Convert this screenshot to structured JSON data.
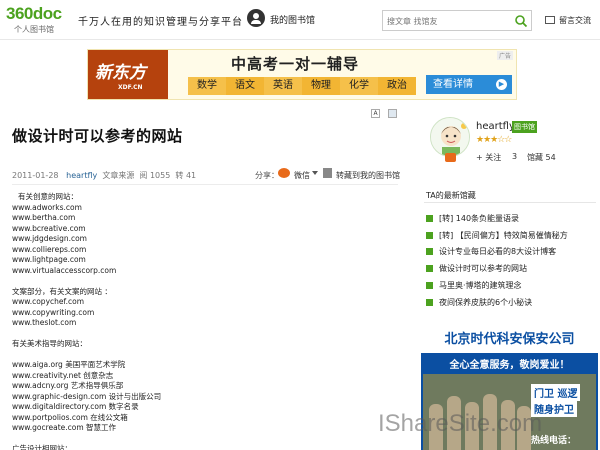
{
  "header": {
    "logo": "360doc",
    "logo_sub": "个人图书馆",
    "slogan": "千万人在用的知识管理与分享平台",
    "my_library": "我的图书馆",
    "search_placeholder": "搜文章 找馆友",
    "messages": "留言交流"
  },
  "ad_banner": {
    "logo_text": "新东方",
    "logo_sub": "XDF.CN",
    "title": "中高考一对一辅导",
    "subjects": [
      "数学",
      "语文",
      "英语",
      "物理",
      "化学",
      "政治"
    ],
    "button": "查看详情",
    "tag": "广告"
  },
  "article": {
    "font_toggle": "A",
    "title": "做设计时可以参考的网站",
    "date": "2011-01-28",
    "author": "heartfly",
    "source_label": "文章来源",
    "reads": "阅 1055",
    "reposts": "转 41",
    "share_label": "分享：",
    "wechat": "微信",
    "save_label": "转藏到我的图书馆",
    "lines": [
      "有关创意的网站：",
      "www.adworks.com",
      "www.bertha.com",
      "www.bcreative.com",
      "www.jdgdesign.com",
      "www.colliereps.com",
      "www.lightpage.com",
      "www.virtualaccesscorp.com",
      "",
      "文案部分，有关文案的网站 ：",
      "www.copychef.com",
      "www.copywriting.com",
      "www.theslot.com",
      "",
      "有关美术指导的网站：",
      "",
      "www.aiga.org 美国平面艺术学院",
      "www.creativity.net 创意杂志",
      "www.adcny.org 艺术指导俱乐部",
      "www.graphic-design.com 设计与出版公司",
      "www.digitaldirectory.com 数字名录",
      "www.portpolios.com 在线公文箱",
      "www.gocreate.com 智慧工作",
      "",
      "广告设计相网站："
    ]
  },
  "profile": {
    "name": "heartfly",
    "badge": "图书馆",
    "stars": "★★★☆☆",
    "follow": "+ 关注",
    "follow_count": "3",
    "collection": "馆藏 54"
  },
  "latest": {
    "title": "TA的最新馆藏",
    "items": [
      "[转] 140条负能量语录",
      "[转] 【民间偏方】特效简易催情秘方",
      "设计专业每日必看的8大设计博客",
      "做设计时可以参考的网站",
      "马里奥·博塔的建筑理念",
      "夜间保养皮肤的6个小秘诀"
    ]
  },
  "side_ad": {
    "head": "北京时代科安保安公司",
    "slogan": "全心全意服务，敬岗爱业！",
    "line1": "门卫 巡逻",
    "line2": "随身护卫",
    "hotline": "热线电话："
  },
  "watermark": "IShareSite.com",
  "colors": {
    "brand_green": "#4ca21f",
    "link_blue": "#2a6496",
    "ad_orange": "#b5420d",
    "ad_blue": "#0b4fa2"
  }
}
